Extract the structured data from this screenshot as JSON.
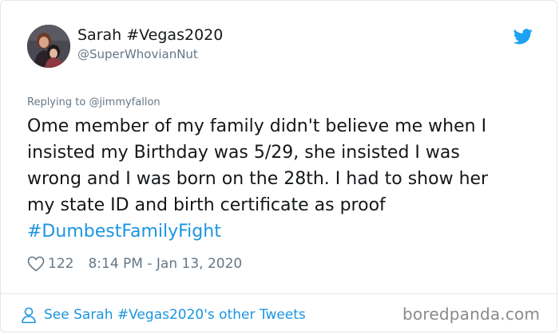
{
  "tweet": {
    "author": {
      "display_name": "Sarah #Vegas2020",
      "handle": "@SuperWhovianNut",
      "avatar_icon": "avatar-photo"
    },
    "reply_prefix": "Replying to ",
    "reply_to": "@jimmyfallon",
    "text_lines": [
      "Ome member of my family didn't believe me when I",
      "insisted my Birthday was 5/29, she insisted I was",
      "wrong and I was born on the 28th. I had to show her",
      "my state ID and birth certificate as proof"
    ],
    "hashtag": "#DumbestFamilyFight",
    "likes": "122",
    "timestamp": "8:14 PM - Jan 13, 2020"
  },
  "footer": {
    "other_tweets_link": "See Sarah #Vegas2020's other Tweets",
    "watermark": "boredpanda.com"
  },
  "colors": {
    "text": "#14171a",
    "secondary": "#657786",
    "link": "#1b95e0",
    "twitter_blue": "#1da1f2",
    "border": "#e1e8ed"
  },
  "icons": [
    "twitter-bird-icon",
    "heart-icon",
    "person-icon"
  ]
}
